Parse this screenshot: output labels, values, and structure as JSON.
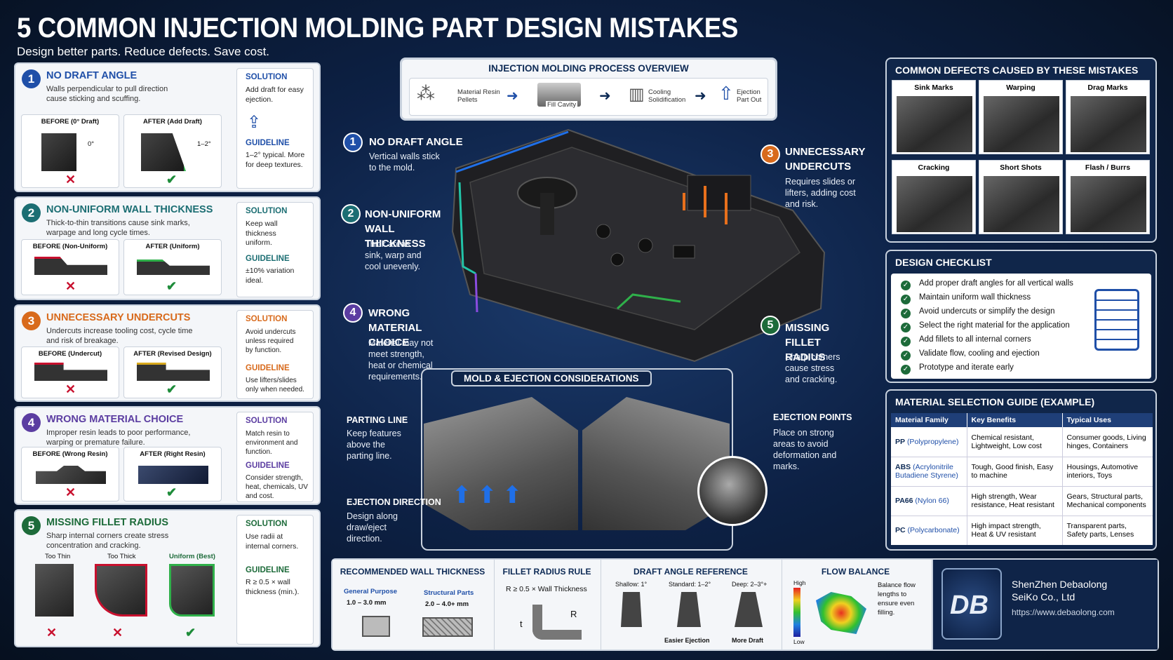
{
  "title": "5 COMMON INJECTION MOLDING PART DESIGN MISTAKES",
  "subtitle": "Design better parts. Reduce defects. Save cost.",
  "colors": {
    "blue": "#1f4fa8",
    "teal": "#1c6e73",
    "orange": "#d86a1c",
    "purple": "#5b3da1",
    "green": "#1d6b3a",
    "navy": "#0d2145"
  },
  "mistakes": [
    {
      "num": "1",
      "title": "NO DRAFT ANGLE",
      "desc": "Walls perpendicular to pull direction cause sticking and scuffing.",
      "before": "BEFORE (0° Draft)",
      "after": "AFTER (Add Draft)",
      "before_note": "0°",
      "after_note": "1–2°",
      "solution_label": "SOLUTION",
      "solution": "Add draft for easy ejection.",
      "guideline_label": "GUIDELINE",
      "guideline": "1–2° typical. More for deep textures."
    },
    {
      "num": "2",
      "title": "NON-UNIFORM WALL THICKNESS",
      "desc": "Thick-to-thin transitions cause sink marks, warpage and long cycle times.",
      "before": "BEFORE (Non-Uniform)",
      "after": "AFTER (Uniform)",
      "solution_label": "SOLUTION",
      "solution": "Keep wall thickness uniform.",
      "guideline_label": "GUIDELINE",
      "guideline": "±10% variation ideal."
    },
    {
      "num": "3",
      "title": "UNNECESSARY UNDERCUTS",
      "desc": "Undercuts increase tooling cost, cycle time and risk of breakage.",
      "before": "BEFORE (Undercut)",
      "after": "AFTER (Revised Design)",
      "solution_label": "SOLUTION",
      "solution": "Avoid undercuts unless required by function.",
      "guideline_label": "GUIDELINE",
      "guideline": "Use lifters/slides only when needed."
    },
    {
      "num": "4",
      "title": "WRONG MATERIAL CHOICE",
      "desc": "Improper resin leads to poor performance, warping or premature failure.",
      "before": "BEFORE (Wrong Resin)",
      "after": "AFTER (Right Resin)",
      "solution_label": "SOLUTION",
      "solution": "Match resin to environment and function.",
      "guideline_label": "GUIDELINE",
      "guideline": "Consider strength, heat, chemicals, UV and cost."
    },
    {
      "num": "5",
      "title": "MISSING FILLET RADIUS",
      "desc": "Sharp internal corners create stress concentration and cracking.",
      "opt1": "Too Thin",
      "opt2": "Too Thick",
      "opt3": "Uniform (Best)",
      "solution_label": "SOLUTION",
      "solution": "Use radii at internal corners.",
      "guideline_label": "GUIDELINE",
      "guideline": "R ≥ 0.5 × wall thickness (min.)."
    }
  ],
  "process": {
    "title": "INJECTION MOLDING PROCESS OVERVIEW",
    "steps": [
      "Material Resin Pellets",
      "Fill Cavity",
      "Cooling Solidification",
      "Ejection Part Out"
    ]
  },
  "callouts": [
    {
      "num": "1",
      "title": "NO DRAFT ANGLE",
      "desc": "Vertical walls stick to the mold."
    },
    {
      "num": "2",
      "title": "NON-UNIFORM WALL THICKNESS",
      "desc": "Thick areas sink, warp and cool unevenly."
    },
    {
      "num": "3",
      "title": "UNNECESSARY UNDERCUTS",
      "desc": "Requires slides or lifters, adding cost and risk."
    },
    {
      "num": "4",
      "title": "WRONG MATERIAL CHOICE",
      "desc": "Material may not meet strength, heat or chemical requirements."
    },
    {
      "num": "5",
      "title": "MISSING FILLET RADIUS",
      "desc": "Sharp corners cause stress and cracking."
    }
  ],
  "mold": {
    "title": "MOLD & EJECTION CONSIDERATIONS",
    "parting_title": "PARTING LINE",
    "parting_desc": "Keep features above the parting line.",
    "ejdir_title": "EJECTION DIRECTION",
    "ejdir_desc": "Design along draw/eject direction.",
    "ejpts_title": "EJECTION POINTS",
    "ejpts_desc": "Place on strong areas to avoid deformation and marks."
  },
  "defects": {
    "title": "COMMON DEFECTS CAUSED BY THESE MISTAKES",
    "items": [
      "Sink Marks",
      "Warping",
      "Drag Marks",
      "Cracking",
      "Short Shots",
      "Flash / Burrs"
    ]
  },
  "checklist": {
    "title": "DESIGN CHECKLIST",
    "items": [
      "Add proper draft angles for all vertical walls",
      "Maintain uniform wall thickness",
      "Avoid undercuts or simplify the design",
      "Select the right material for the application",
      "Add fillets to all internal corners",
      "Validate flow, cooling and ejection",
      "Prototype and iterate early"
    ]
  },
  "materials": {
    "title": "MATERIAL SELECTION GUIDE (EXAMPLE)",
    "headers": [
      "Material Family",
      "Key Benefits",
      "Typical Uses"
    ],
    "rows": [
      {
        "abbr": "PP",
        "name": "(Polypropylene)",
        "benefits": "Chemical resistant, Lightweight, Low cost",
        "uses": "Consumer goods, Living hinges, Containers"
      },
      {
        "abbr": "ABS",
        "name": "(Acrylonitrile Butadiene Styrene)",
        "benefits": "Tough, Good finish, Easy to machine",
        "uses": "Housings, Automotive interiors, Toys"
      },
      {
        "abbr": "PA66",
        "name": "(Nylon 66)",
        "benefits": "High strength, Wear resistance, Heat resistant",
        "uses": "Gears, Structural parts, Mechanical components"
      },
      {
        "abbr": "PC",
        "name": "(Polycarbonate)",
        "benefits": "High impact strength, Heat & UV resistant",
        "uses": "Transparent parts, Safety parts, Lenses"
      }
    ]
  },
  "bottom": {
    "wall_title": "RECOMMENDED WALL THICKNESS",
    "general_label": "General Purpose",
    "general_value": "1.0 – 3.0 mm",
    "structural_label": "Structural Parts",
    "structural_value": "2.0 – 4.0+ mm",
    "fillet_title": "FILLET RADIUS RULE",
    "fillet_rule": "R ≥ 0.5 × Wall Thickness",
    "fillet_t": "t",
    "fillet_r": "R",
    "draft_title": "DRAFT ANGLE REFERENCE",
    "draft_shallow": "Shallow: 1°",
    "draft_standard": "Standard: 1–2°",
    "draft_deep": "Deep: 2–3°+",
    "draft_easier": "Easier Ejection",
    "draft_more": "More Draft",
    "flow_title": "FLOW BALANCE",
    "flow_high": "High",
    "flow_low": "Low",
    "flow_desc": "Balance flow lengths to ensure even filling."
  },
  "company": {
    "logo": "DB",
    "name": "ShenZhen Debaolong SeiKo Co., Ltd",
    "url": "https://www.debaolong.com"
  }
}
